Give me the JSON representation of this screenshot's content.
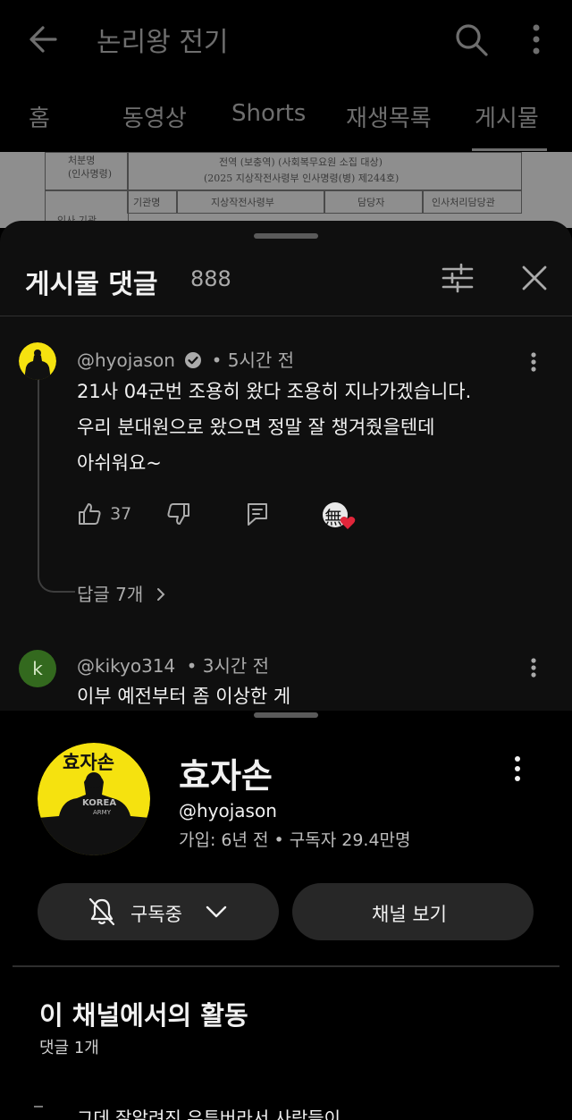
{
  "header": {
    "title": "논리왕 전기",
    "tabs": [
      "홈",
      "동영상",
      "Shorts",
      "재생목록",
      "게시물"
    ],
    "active_tab": "게시물"
  },
  "document_bg": {
    "row1_label": "처분명\n(인사명령)",
    "row1_text": "전역 (보충역) (사회복무요원 소집 대상)",
    "row1_sub": "(2025 지상작전사령부 인사명령(병) 제244호)",
    "col1": "기관명",
    "col2": "지상작전사령부",
    "col3": "담당자",
    "col4": "인사처리담당관",
    "row2_label": "인사 기관"
  },
  "comments_sheet": {
    "title": "게시물 댓글",
    "count": "888",
    "comments": [
      {
        "author": "@hyojason",
        "verified": true,
        "time": "• 5시간 전",
        "lines": [
          "21사 04군번 조용히 왔다 조용히 지나가겠습니다.",
          "우리 분대원으로 왔으면 정말 잘 챙겨줬을텐데",
          "아쉬워요~"
        ],
        "likes": "37",
        "replies": "답글 7개",
        "heart_badge": "無"
      },
      {
        "author": "@kikyo314",
        "avatar_letter": "k",
        "time": "• 3시간 전",
        "preview": "이부 예전부터 좀 이상한 게"
      }
    ]
  },
  "channel_panel": {
    "avatar_text": "효자손",
    "avatar_shirt": "KOREA",
    "avatar_shirt_sub": "ARMY",
    "name": "효자손",
    "handle": "@hyojason",
    "stats": "가입: 6년 전 • 구독자 29.4만명",
    "subscribe_label": "구독중",
    "view_channel_label": "채널 보기",
    "activity_title": "이 채널에서의 활동",
    "activity_sub": "댓글 1개",
    "activity_preview": "그데 잘알려진 유튜버라서 사람들이"
  },
  "colors": {
    "background": "#000000",
    "sheet": "#0f0f0f",
    "pill": "#272727",
    "heart": "#e0263a",
    "avatar_yellow": "#f5e20f",
    "kikyo_avatar": "#33691e"
  },
  "icons": [
    "back-arrow-icon",
    "search-icon",
    "more-vert-icon",
    "filter-icon",
    "close-icon",
    "verified-icon",
    "thumb-up-icon",
    "thumb-down-icon",
    "reply-icon",
    "heart-icon",
    "bell-off-icon",
    "chevron-down-icon",
    "chevron-right-icon"
  ]
}
